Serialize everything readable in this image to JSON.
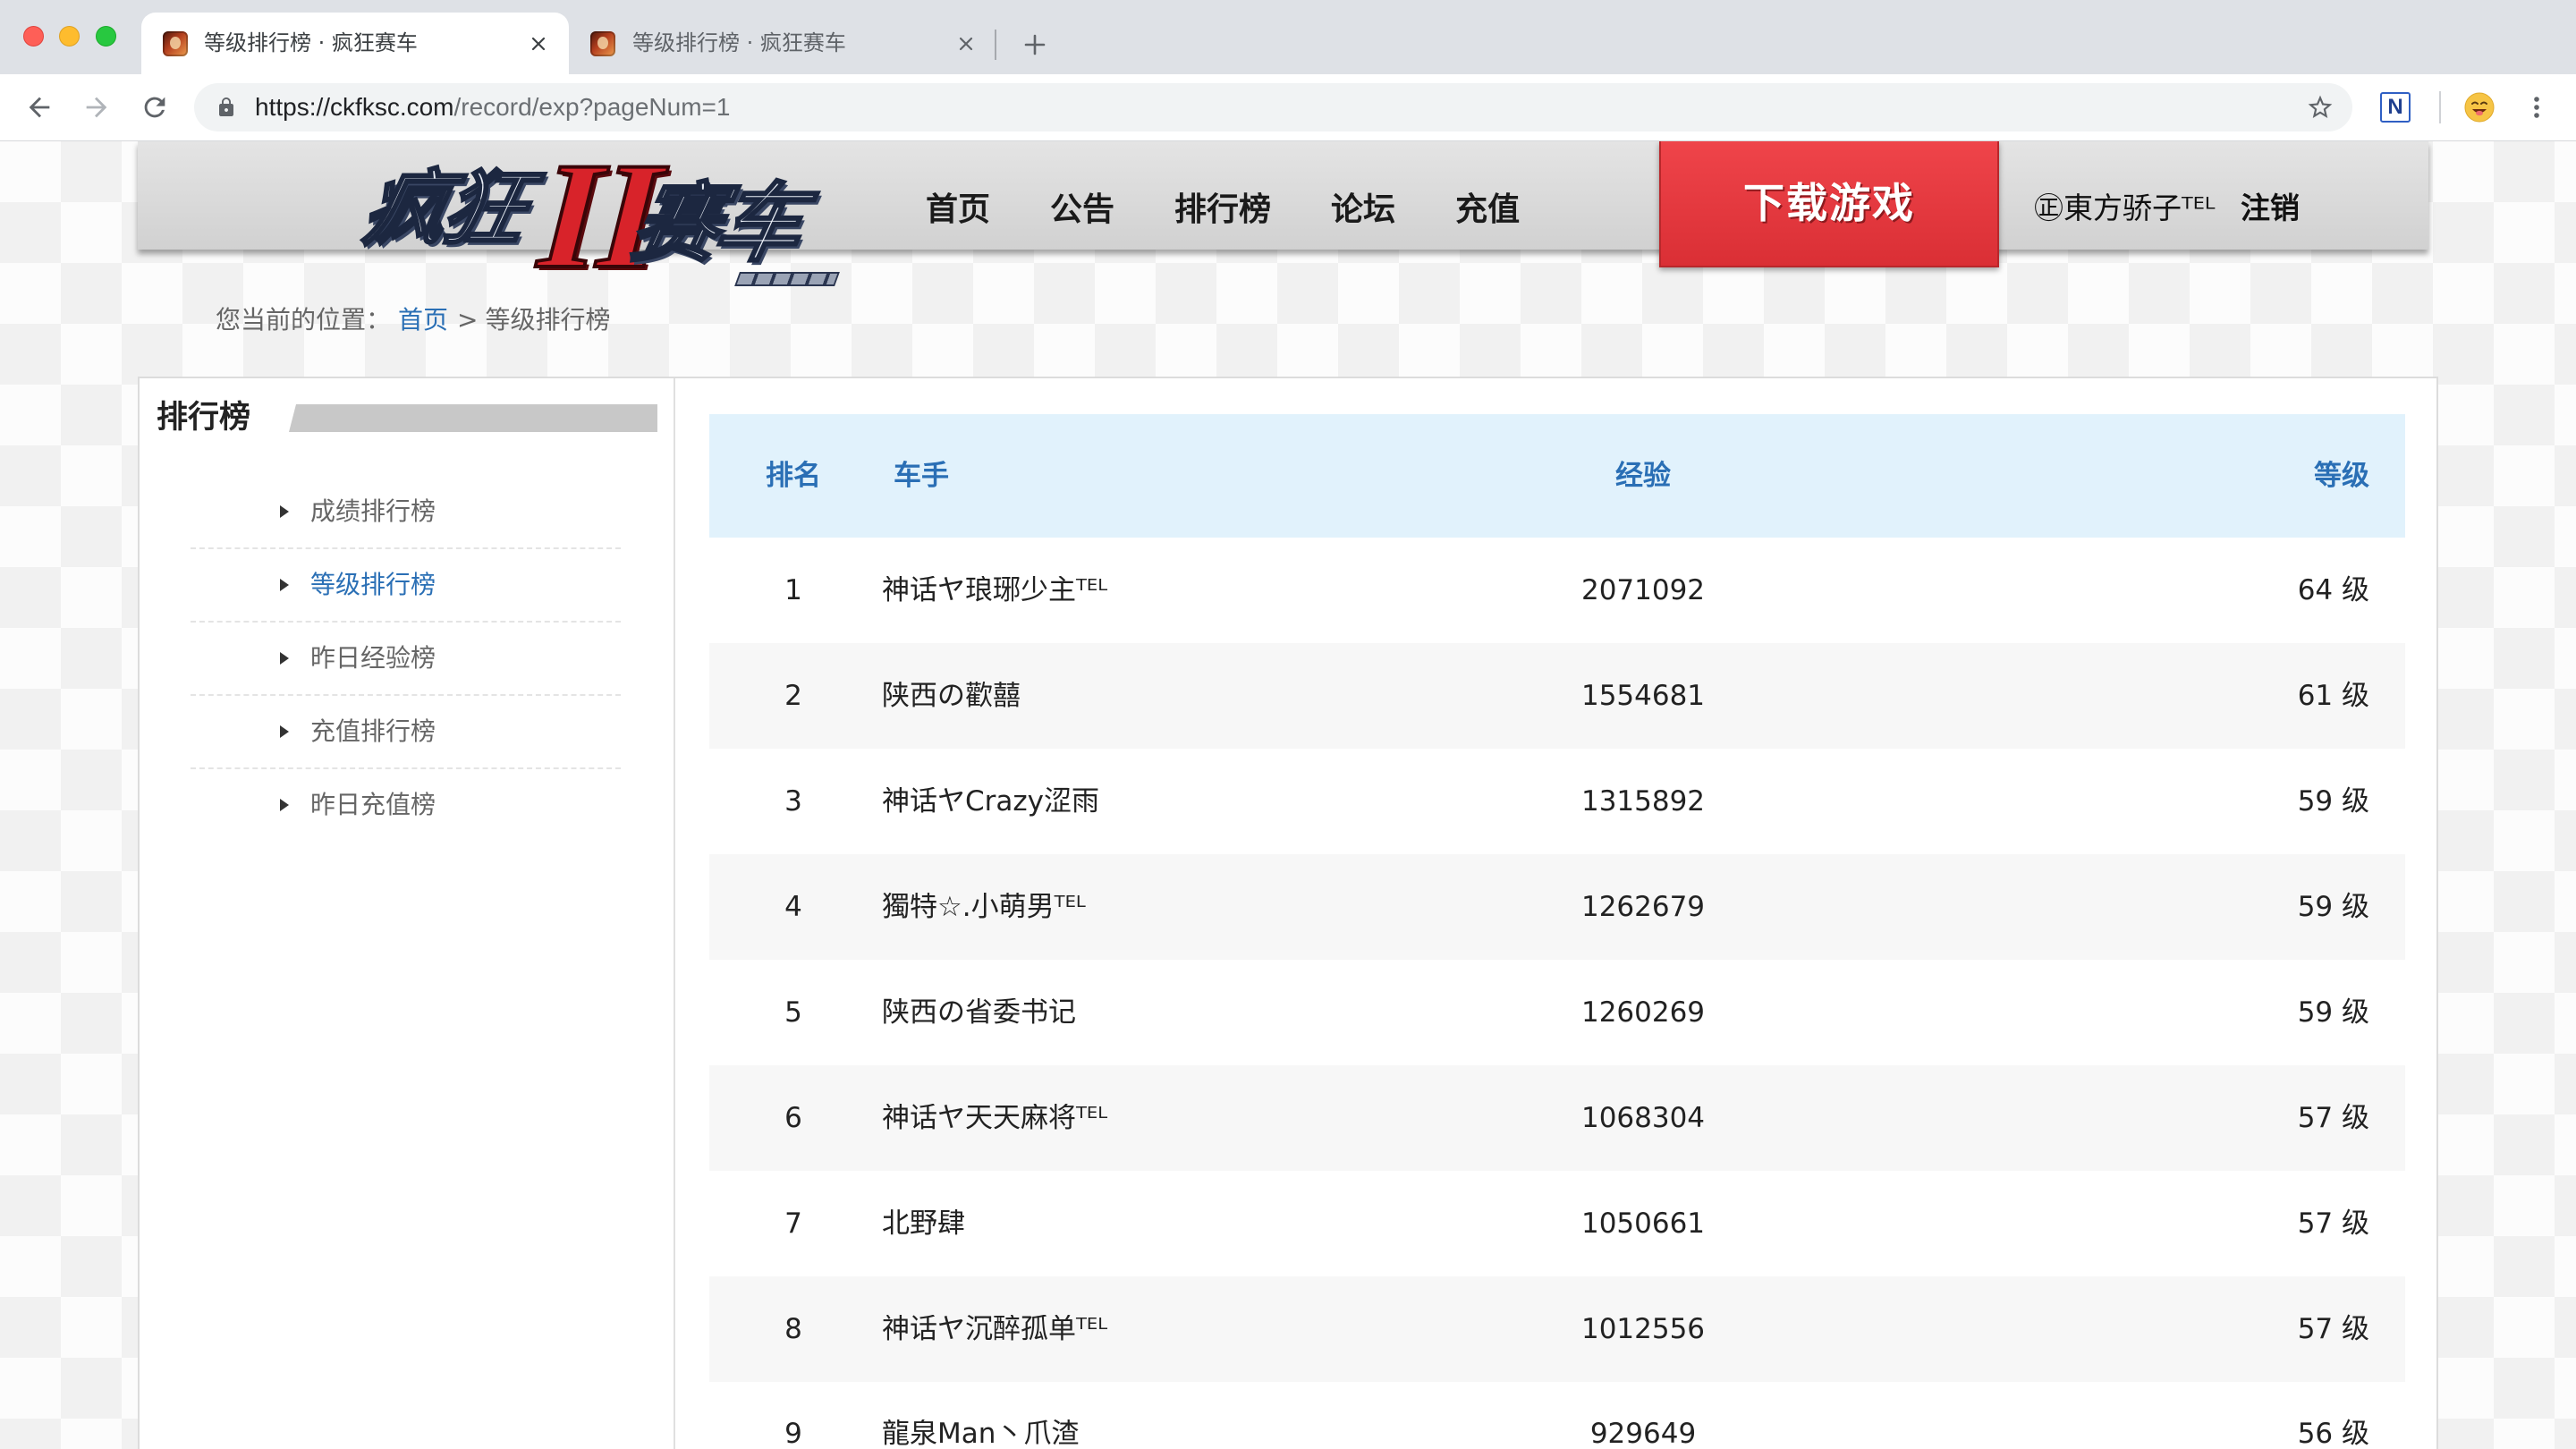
{
  "browser": {
    "tabs": [
      {
        "title": "等级排行榜 · 疯狂赛车",
        "active": true
      },
      {
        "title": "等级排行榜 · 疯狂赛车",
        "active": false
      }
    ],
    "address": {
      "host": "https://ckfksc.com",
      "path": "/record/exp?pageNum=1"
    },
    "extension_label": "N",
    "icons": [
      "tab-close-icon",
      "new-tab-icon",
      "back-arrow-icon",
      "forward-arrow-icon",
      "reload-icon",
      "lock-icon",
      "star-icon",
      "profile-avatar-icon",
      "more-menu-icon"
    ]
  },
  "site": {
    "logo": {
      "left": "疯狂",
      "numeral": "II",
      "right": "赛车"
    },
    "nav": [
      "首页",
      "公告",
      "排行榜",
      "论坛",
      "充值"
    ],
    "download_label": "下载游戏",
    "user_name": "㊣東方骄子ᵀᴱᴸ",
    "logout_label": "注销"
  },
  "breadcrumb": {
    "prefix": "您当前的位置：",
    "home": "首页",
    "separator": ">",
    "current": "等级排行榜"
  },
  "sidebar": {
    "title": "排行榜",
    "items": [
      {
        "label": "成绩排行榜",
        "active": false
      },
      {
        "label": "等级排行榜",
        "active": true
      },
      {
        "label": "昨日经验榜",
        "active": false
      },
      {
        "label": "充值排行榜",
        "active": false
      },
      {
        "label": "昨日充值榜",
        "active": false
      }
    ]
  },
  "ranking": {
    "columns": {
      "rank": "排名",
      "driver": "车手",
      "exp": "经验",
      "level": "等级"
    },
    "rows": [
      {
        "rank": "1",
        "driver": "神话ヤ琅琊少主ᵀᴱᴸ",
        "exp": "2071092",
        "level": "64 级"
      },
      {
        "rank": "2",
        "driver": "陕西の歡囍",
        "exp": "1554681",
        "level": "61 级"
      },
      {
        "rank": "3",
        "driver": "神话ヤCrazy涩雨",
        "exp": "1315892",
        "level": "59 级"
      },
      {
        "rank": "4",
        "driver": "獨特☆.小萌男ᵀᴱᴸ",
        "exp": "1262679",
        "level": "59 级"
      },
      {
        "rank": "5",
        "driver": "陕西の省委书记",
        "exp": "1260269",
        "level": "59 级"
      },
      {
        "rank": "6",
        "driver": "神话ヤ天天麻将ᵀᴱᴸ",
        "exp": "1068304",
        "level": "57 级"
      },
      {
        "rank": "7",
        "driver": "北野肆",
        "exp": "1050661",
        "level": "57 级"
      },
      {
        "rank": "8",
        "driver": "神话ヤ沉醉孤单ᵀᴱᴸ",
        "exp": "1012556",
        "level": "57 级"
      },
      {
        "rank": "9",
        "driver": "龍泉Man丶爪渣",
        "exp": "929649",
        "level": "56 级"
      }
    ]
  },
  "colors": {
    "accent": "#2a6fb5",
    "download_red": "#e43a3f",
    "table_header_bg": "#e1f2fc"
  }
}
